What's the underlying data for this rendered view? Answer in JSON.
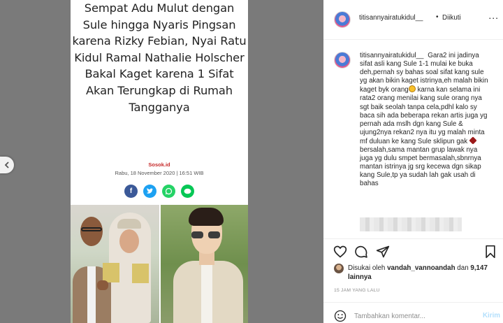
{
  "article": {
    "headline": "Sempat Adu Mulut dengan Sule hingga Nyaris Pingsan karena Rizky Febian, Nyai Ratu Kidul Ramal Nathalie Holscher Bakal Kaget karena 1 Sifat Akan Terungkap di Rumah Tangganya",
    "source": "Sosok.id",
    "date": "Rabu, 18 November 2020 | 16:51 WIB",
    "share_icons": [
      "facebook-icon",
      "twitter-icon",
      "whatsapp-icon",
      "line-icon"
    ]
  },
  "post": {
    "username": "titisannyairatukidul__",
    "separator": "•",
    "follow_label": "Diikuti",
    "more_label": "...",
    "caption_user": "titisannyairatukidul__",
    "caption_part1": "Gara2 ini jadinya sifat asli kang Sule 1-1 mulai ke buka deh,pernah sy bahas soal sifat kang sule yg akan bikin kaget istrinya,eh malah bikin kaget byk orang",
    "caption_part2": "karna kan selama ini rata2 orang menilai kang sule orang nya sgt baik seolah tanpa cela,pdhl kalo sy baca sih ada beberapa rekan artis juga yg pernah ada mslh dgn kang Sule & ujung2nya rekan2 nya itu yg malah minta mf duluan ke kang Sule sklipun gak",
    "caption_part3": "bersalah,sama mantan grup lawak nya juga yg dulu smpet bermasalah,sbnrnya mantan istrinya jg srg kecewa dgn sikap kang Sule,tp ya sudah lah gak usah di bahas",
    "liked_prefix": "Disukai oleh",
    "liked_by": "vandah_vannoandah",
    "liked_and": "dan",
    "likes_count": "9,147",
    "likes_suffix": "lainnya",
    "timestamp": "15 JAM YANG LALU",
    "comment_placeholder": "Tambahkan komentar...",
    "post_label": "Kirim"
  },
  "colors": {
    "link_blue": "#b2dffc",
    "text": "#262626",
    "muted": "#8e8e8e",
    "backdrop": "#7a7a7a"
  }
}
